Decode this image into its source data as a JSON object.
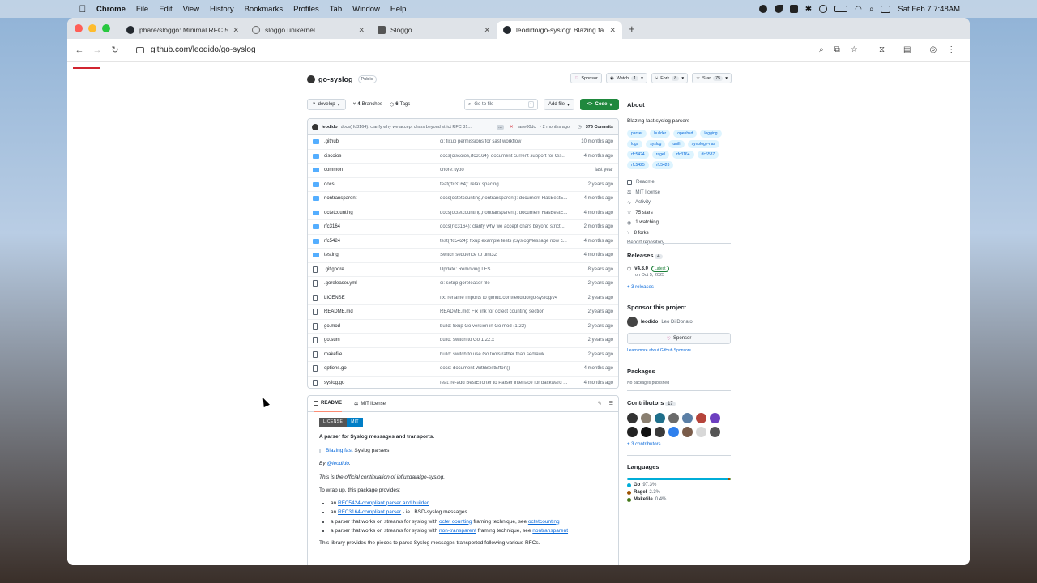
{
  "menubar": {
    "app": "Chrome",
    "items": [
      "File",
      "Edit",
      "View",
      "History",
      "Bookmarks",
      "Profiles",
      "Tab",
      "Window",
      "Help"
    ],
    "datetime": "Sat Feb 7  7:48AM"
  },
  "tabs": [
    {
      "label": "phare/sloggo: Minimal RFC 5",
      "favicon": "github-icon"
    },
    {
      "label": "sloggo unikernel",
      "favicon": "globe-icon"
    },
    {
      "label": "Sloggo",
      "favicon": "sloggo-icon"
    },
    {
      "label": "leodido/go-syslog: Blazing fa",
      "favicon": "github-icon",
      "active": true
    }
  ],
  "url": "github.com/leodido/go-syslog",
  "repo": {
    "name": "go-syslog",
    "visibility": "Public",
    "sponsor": "Sponsor",
    "watch": "Watch",
    "watch_count": "1",
    "fork": "Fork",
    "fork_count": "8",
    "star": "Star",
    "star_count": "75"
  },
  "branch": {
    "name": "develop",
    "branches_count": "4",
    "branches_label": "Branches",
    "tags_count": "6",
    "tags_label": "Tags"
  },
  "search": {
    "placeholder": "Go to file",
    "key": "t"
  },
  "buttons": {
    "add_file": "Add file",
    "code": "Code"
  },
  "last_commit": {
    "author": "leodido",
    "message": "docs(rfc3164): clarify why we accept chars beyond strict RFC 31...",
    "hash": "aae00dc",
    "time": "· 2 months ago",
    "commits": "376 Commits"
  },
  "files": [
    {
      "name": ".github",
      "type": "dir",
      "message": "ci: fixup permissions for sast workflow",
      "date": "10 months ago"
    },
    {
      "name": "ciscoios",
      "type": "dir",
      "message": "docs(ciscoios,rfc3164): document current support for Cis...",
      "date": "4 months ago"
    },
    {
      "name": "common",
      "type": "dir",
      "message": "chore: typo",
      "date": "last year"
    },
    {
      "name": "docs",
      "type": "dir",
      "message": "feat(rfc3164): relax spacing",
      "date": "2 years ago"
    },
    {
      "name": "nontransparent",
      "type": "dir",
      "message": "docs(octetcounting,nontransparent): document HasBestE...",
      "date": "4 months ago"
    },
    {
      "name": "octetcounting",
      "type": "dir",
      "message": "docs(octetcounting,nontransparent): document HasBestE...",
      "date": "4 months ago"
    },
    {
      "name": "rfc3164",
      "type": "dir",
      "message": "docs(rfc3164): clarify why we accept chars beyond strict ...",
      "date": "2 months ago"
    },
    {
      "name": "rfc5424",
      "type": "dir",
      "message": "test(rfc5424): fixup example tests (SyslogMessage now c...",
      "date": "4 months ago"
    },
    {
      "name": "testing",
      "type": "dir",
      "message": "Switch sequence to uint32",
      "date": "4 months ago"
    },
    {
      "name": ".gitignore",
      "type": "file",
      "message": "Update: Removing LFS",
      "date": "8 years ago"
    },
    {
      "name": ".goreleaser.yml",
      "type": "file",
      "message": "ci: setup goreleaser file",
      "date": "2 years ago"
    },
    {
      "name": "LICENSE",
      "type": "file",
      "message": "fix: rename imports to github.com/leodido/go-syslog/v4",
      "date": "2 years ago"
    },
    {
      "name": "README.md",
      "type": "file",
      "message": "README.md: Fix link for octect counting section",
      "date": "2 years ago"
    },
    {
      "name": "go.mod",
      "type": "file",
      "message": "build: fixup Go version in Go mod (1.22)",
      "date": "2 years ago"
    },
    {
      "name": "go.sum",
      "type": "file",
      "message": "build: switch to Go 1.22.x",
      "date": "2 years ago"
    },
    {
      "name": "makefile",
      "type": "file",
      "message": "build: switch to use Go tools rather than sed/awk",
      "date": "2 years ago"
    },
    {
      "name": "options.go",
      "type": "file",
      "message": "docs: document WithBestEffort()",
      "date": "4 months ago"
    },
    {
      "name": "syslog.go",
      "type": "file",
      "message": "feat: re-add BestEfforter to Parser interface for backward ...",
      "date": "4 months ago"
    }
  ],
  "readme": {
    "tab_readme": "README",
    "tab_license": "MIT license",
    "badge_left": "LICENSE",
    "badge_right": "MIT",
    "heading": "A parser for Syslog messages and transports.",
    "quote_link": "Blazing fast",
    "quote_rest": " Syslog parsers",
    "by": "By ",
    "by_link": "@leodido",
    "by_end": ".",
    "official": "This is the official continuation of influxdata/go-syslog.",
    "wrap": "To wrap up, this package provides:",
    "li1_a": "an ",
    "li1_link": "RFC5424-compliant parser and builder",
    "li2_a": "an ",
    "li2_link": "RFC3164-compliant parser",
    "li2_b": " - ie., BSD-syslog messages",
    "li3_a": "a parser that works on streams for syslog with ",
    "li3_link": "octet counting",
    "li3_b": " framing technique, see ",
    "li3_link2": "octetcounting",
    "li4_a": "a parser that works on streams for syslog with ",
    "li4_link": "non-transparent",
    "li4_b": " framing technique, see ",
    "li4_link2": "nontransparent",
    "last": "This library provides the pieces to parse Syslog messages transported following various RFCs."
  },
  "about": {
    "title": "About",
    "desc": "Blazing fast syslog parsers",
    "topics": [
      "parser",
      "builder",
      "openbsd",
      "logging",
      "logs",
      "syslog",
      "unifi",
      "synology-nas",
      "rfc5424",
      "ragel",
      "rfc3164",
      "rfc6587",
      "rfc5425",
      "rfc5426"
    ],
    "links": [
      "Readme",
      "MIT license",
      "Activity",
      "75 stars",
      "1 watching",
      "8 forks"
    ],
    "report": "Report repository"
  },
  "releases": {
    "title": "Releases",
    "count": "4",
    "version": "v4.3.0",
    "latest": "Latest",
    "date": "on Oct 5, 2025",
    "more": "+ 3 releases"
  },
  "sponsor": {
    "title": "Sponsor this project",
    "user": "leodido",
    "fullname": "Leo Di Donato",
    "button": "Sponsor",
    "learn": "Learn more about GitHub Sponsors"
  },
  "packages": {
    "title": "Packages",
    "none": "No packages published"
  },
  "contributors": {
    "title": "Contributors",
    "count": "17",
    "more": "+ 3 contributors"
  },
  "languages": {
    "title": "Languages",
    "items": [
      {
        "name": "Go",
        "pct": "97.3%",
        "value": 97.3,
        "color": "#00ADD8"
      },
      {
        "name": "Ragel",
        "pct": "2.3%",
        "value": 2.3,
        "color": "#9d5200"
      },
      {
        "name": "Makefile",
        "pct": "0.4%",
        "value": 0.4,
        "color": "#427819"
      }
    ]
  }
}
